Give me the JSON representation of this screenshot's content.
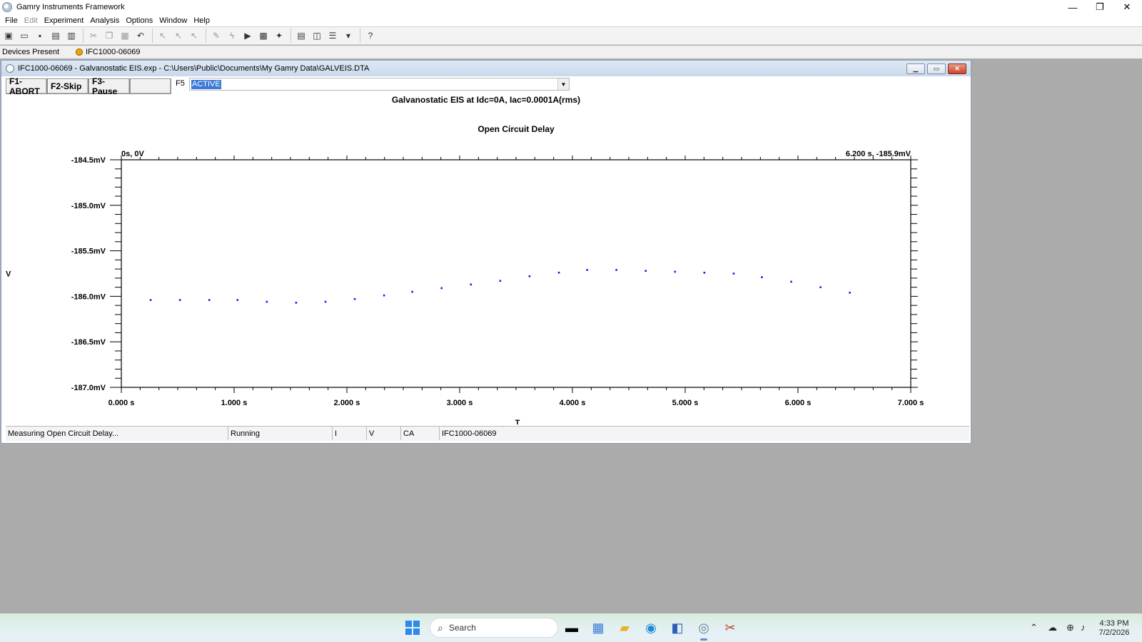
{
  "window": {
    "title": "Gamry Instruments Framework",
    "minimize_glyph": "—",
    "maximize_glyph": "❐",
    "close_glyph": "✕"
  },
  "menu": [
    "File",
    "Edit",
    "Experiment",
    "Analysis",
    "Options",
    "Window",
    "Help"
  ],
  "toolbar_icons": [
    "new-icon",
    "open-icon",
    "save-icon",
    "save-all-icon",
    "print-icon",
    "cut-icon",
    "copy-icon",
    "paste-icon",
    "undo-icon",
    "cursor-icon",
    "cursor-zoom-icon",
    "cursor-select-icon",
    "pen-icon",
    "lightning-icon",
    "run-icon",
    "plot-icon",
    "wand-icon",
    "cascade-icon",
    "tile-vertical-icon",
    "tile-horizontal-icon",
    "arrange-icon",
    "help-icon"
  ],
  "devices": {
    "label": "Devices Present",
    "device": "IFC1000-06069",
    "status_color": "#f2a400"
  },
  "child": {
    "title": "IFC1000-06069 - Galvanostatic EIS.exp - C:\\Users\\Public\\Documents\\My Gamry Data\\GALVEIS.DTA",
    "fkeys": [
      "F1-ABORT",
      "F2-Skip",
      "F3-Pause",
      ""
    ],
    "f5_label": "F5",
    "state_value": "ACTIVE",
    "experiment_title": "Galvanostatic EIS at Idc=0A, Iac=0.0001A(rms)"
  },
  "chart_data": {
    "type": "scatter",
    "title": "Open Circuit Delay",
    "xlabel": "T",
    "ylabel": "V",
    "xlim": [
      0,
      7
    ],
    "ylim": [
      -187.0,
      -184.5
    ],
    "x_tick_labels": [
      "0.000 s",
      "1.000 s",
      "2.000 s",
      "3.000 s",
      "4.000 s",
      "5.000 s",
      "6.000 s",
      "7.000 s"
    ],
    "y_tick_labels": [
      "-184.5mV",
      "-185.0mV",
      "-185.5mV",
      "-186.0mV",
      "-186.5mV",
      "-187.0mV"
    ],
    "corner_left": "0s, 0V",
    "corner_right": "6.200 s, -185.9mV",
    "series_color": "#1a1aff",
    "x": [
      0.26,
      0.52,
      0.78,
      1.03,
      1.29,
      1.55,
      1.81,
      2.07,
      2.33,
      2.58,
      2.84,
      3.1,
      3.36,
      3.62,
      3.88,
      4.13,
      4.39,
      4.65,
      4.91,
      5.17,
      5.43,
      5.68,
      5.94,
      6.2,
      6.46
    ],
    "y": [
      -186.04,
      -186.04,
      -186.04,
      -186.04,
      -186.06,
      -186.07,
      -186.06,
      -186.03,
      -185.99,
      -185.95,
      -185.91,
      -185.87,
      -185.83,
      -185.78,
      -185.74,
      -185.71,
      -185.71,
      -185.72,
      -185.73,
      -185.74,
      -185.75,
      -185.79,
      -185.84,
      -185.9,
      -185.96
    ]
  },
  "statusbar": {
    "message": "Measuring Open Circuit Delay...",
    "state": "Running",
    "i_label": "I",
    "v_label": "V",
    "mode": "CA",
    "device": "IFC1000-06069"
  },
  "taskbar": {
    "search_placeholder": "Search",
    "time": "4:33 PM",
    "date": "7/2/2026"
  }
}
